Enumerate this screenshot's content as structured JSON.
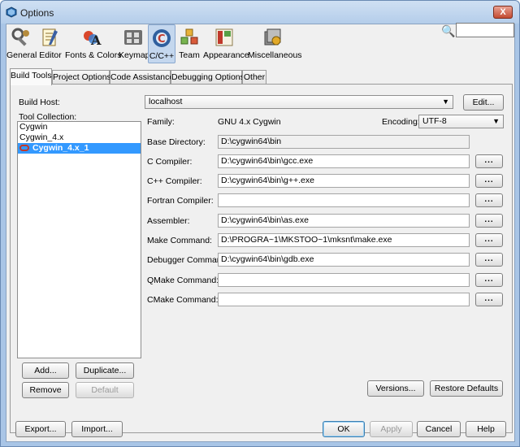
{
  "window": {
    "title": "Options",
    "close_label": "X"
  },
  "toolbar": {
    "items": [
      {
        "label": "General",
        "icon": "general-icon"
      },
      {
        "label": "Editor",
        "icon": "editor-icon"
      },
      {
        "label": "Fonts & Colors",
        "icon": "fonts-colors-icon"
      },
      {
        "label": "Keymap",
        "icon": "keymap-icon"
      },
      {
        "label": "C/C++",
        "icon": "cpp-icon"
      },
      {
        "label": "Team",
        "icon": "team-icon"
      },
      {
        "label": "Appearance",
        "icon": "appearance-icon"
      },
      {
        "label": "Miscellaneous",
        "icon": "miscellaneous-icon"
      }
    ],
    "search_placeholder": "",
    "selected": "C/C++"
  },
  "tabs": [
    "Build Tools",
    "Project Options",
    "Code Assistance",
    "Debugging Options",
    "Other"
  ],
  "active_tab": "Build Tools",
  "build_tools": {
    "build_host_label": "Build Host:",
    "build_host_value": "localhost",
    "edit_button": "Edit...",
    "tool_collection_label": "Tool Collection:",
    "collections": [
      "Cygwin",
      "Cygwin_4.x",
      "Cygwin_4.x_1"
    ],
    "selected_collection": "Cygwin_4.x_1",
    "family_label": "Family:",
    "family_value": "GNU 4.x Cygwin",
    "encoding_label": "Encoding:",
    "encoding_value": "UTF-8",
    "base_dir_label": "Base Directory:",
    "base_dir_value": "D:\\cygwin64\\bin",
    "tools": [
      {
        "label": "C Compiler:",
        "value": "D:\\cygwin64\\bin\\gcc.exe"
      },
      {
        "label": "C++ Compiler:",
        "value": "D:\\cygwin64\\bin\\g++.exe"
      },
      {
        "label": "Fortran Compiler:",
        "value": ""
      },
      {
        "label": "Assembler:",
        "value": "D:\\cygwin64\\bin\\as.exe"
      },
      {
        "label": "Make Command:",
        "value": "D:\\PROGRA~1\\MKSTOO~1\\mksnt\\make.exe"
      },
      {
        "label": "Debugger Command:",
        "value": "D:\\cygwin64\\bin\\gdb.exe"
      },
      {
        "label": "QMake Command:",
        "value": ""
      },
      {
        "label": "CMake Command:",
        "value": ""
      }
    ],
    "browse_label": "...",
    "add_button": "Add...",
    "duplicate_button": "Duplicate...",
    "remove_button": "Remove",
    "default_button": "Default",
    "versions_button": "Versions...",
    "restore_button": "Restore Defaults"
  },
  "footer": {
    "export_button": "Export...",
    "import_button": "Import...",
    "ok_button": "OK",
    "apply_button": "Apply",
    "cancel_button": "Cancel",
    "help_button": "Help"
  }
}
